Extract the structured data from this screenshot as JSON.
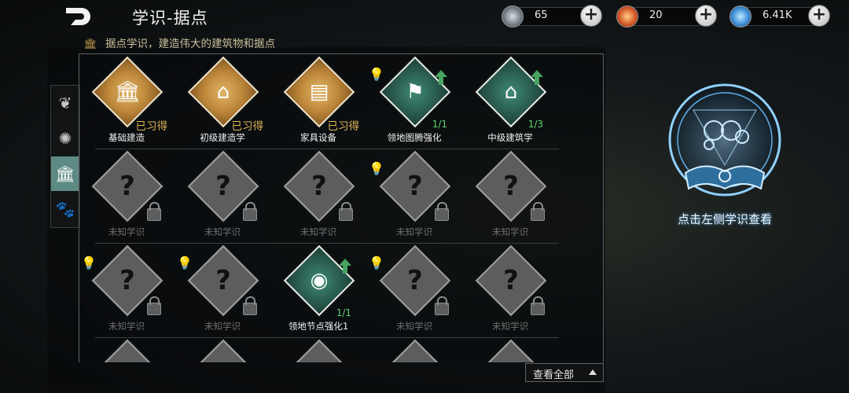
{
  "header": {
    "title": "学识-据点",
    "subtitle": "据点学识，建造伟大的建筑物和据点"
  },
  "resources": [
    {
      "icon": "gear-coin-icon",
      "value": "65",
      "color": "#8f9aa3"
    },
    {
      "icon": "red-orb-icon",
      "value": "20",
      "color": "#d65a2a"
    },
    {
      "icon": "globe-orb-icon",
      "value": "6.41K",
      "color": "#3f8fd6"
    }
  ],
  "tabs": [
    {
      "icon": "feather-wing-icon",
      "active": false
    },
    {
      "icon": "thorn-beast-icon",
      "active": false
    },
    {
      "icon": "temple-icon",
      "active": true
    },
    {
      "icon": "paw-icon",
      "active": false
    }
  ],
  "rows": [
    [
      {
        "style": "gold",
        "icon": "building-icon",
        "label": "基础建造",
        "status": "已习得"
      },
      {
        "style": "gold",
        "icon": "house-icon",
        "label": "初级建造学",
        "status": "已习得"
      },
      {
        "style": "gold",
        "icon": "furniture-icon",
        "label": "家具设备",
        "status": "已习得"
      },
      {
        "style": "teal",
        "icon": "banner-icon",
        "label": "领地图腾强化",
        "progress": "1/1",
        "bulb": true,
        "arrow": true
      },
      {
        "style": "teal",
        "icon": "house-upgrade-icon",
        "label": "中级建筑学",
        "progress": "1/3",
        "arrow": true
      }
    ],
    [
      {
        "style": "grey",
        "label": "未知学识",
        "locked": true
      },
      {
        "style": "grey",
        "label": "未知学识",
        "locked": true
      },
      {
        "style": "grey",
        "label": "未知学识",
        "locked": true
      },
      {
        "style": "grey",
        "label": "未知学识",
        "locked": true,
        "bulb": true
      },
      {
        "style": "grey",
        "label": "未知学识",
        "locked": true
      }
    ],
    [
      {
        "style": "grey",
        "label": "未知学识",
        "locked": true,
        "bulb": true
      },
      {
        "style": "grey",
        "label": "未知学识",
        "locked": true,
        "bulb": true
      },
      {
        "style": "teal",
        "icon": "swirl-icon",
        "label": "领地节点强化1",
        "progress": "1/1",
        "arrow": true
      },
      {
        "style": "grey",
        "label": "未知学识",
        "locked": true,
        "bulb": true
      },
      {
        "style": "grey",
        "label": "未知学识",
        "locked": true
      }
    ]
  ],
  "footer": {
    "view_all": "查看全部"
  },
  "detail": {
    "hint": "点击左侧学识查看"
  }
}
